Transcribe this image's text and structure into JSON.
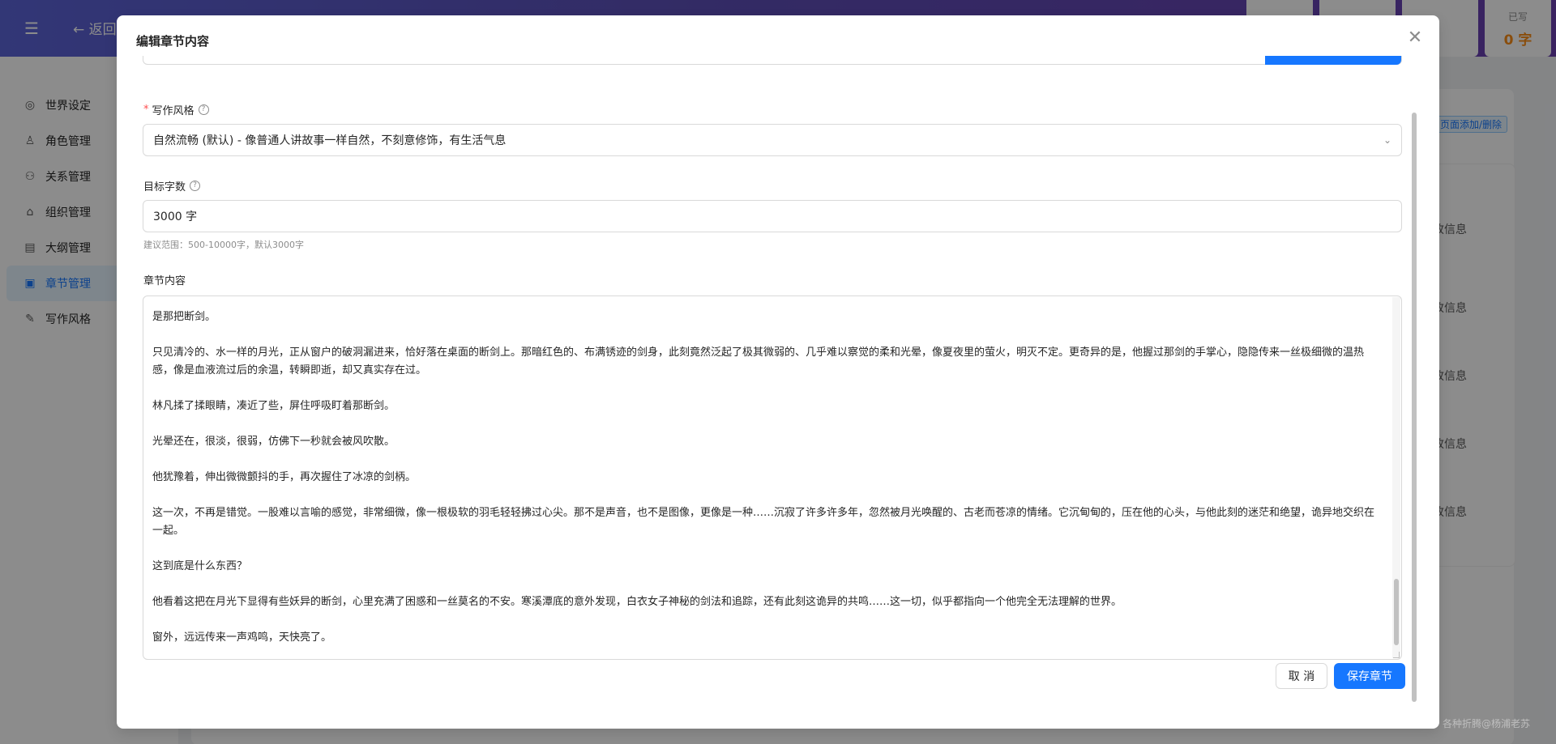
{
  "header": {
    "back_label": "返回",
    "stats": [
      {
        "label": "",
        "value": ""
      },
      {
        "label": "",
        "value": ""
      },
      {
        "label": "",
        "value": ""
      },
      {
        "label": "已写",
        "value": "0 字"
      }
    ]
  },
  "sidebar": {
    "items": [
      {
        "label": "世界设定",
        "icon": "globe-icon"
      },
      {
        "label": "角色管理",
        "icon": "user-icon"
      },
      {
        "label": "关系管理",
        "icon": "network-icon"
      },
      {
        "label": "组织管理",
        "icon": "bank-icon"
      },
      {
        "label": "大纲管理",
        "icon": "file-icon"
      },
      {
        "label": "章节管理",
        "icon": "book-icon"
      },
      {
        "label": "写作风格",
        "icon": "pen-icon"
      }
    ]
  },
  "main": {
    "tag_link": "页面添加/删除",
    "row_action": "改信息",
    "watermark": "各种折腾@杨浦老苏"
  },
  "modal": {
    "title": "编辑章节内容",
    "style_label": "写作风格",
    "style_value": "自然流畅 (默认) - 像普通人讲故事一样自然，不刻意修饰，有生活气息",
    "words_label": "目标字数",
    "words_value": "3000 字",
    "words_hint": "建议范围：500-10000字，默认3000字",
    "content_label": "章节内容",
    "content_paragraphs": [
      "是那把断剑。",
      "只见清冷的、水一样的月光，正从窗户的破洞漏进来，恰好落在桌面的断剑上。那暗红色的、布满锈迹的剑身，此刻竟然泛起了极其微弱的、几乎难以察觉的柔和光晕，像夏夜里的萤火，明灭不定。更奇异的是，他握过那剑的手掌心，隐隐传来一丝极细微的温热感，像是血液流过后的余温，转瞬即逝，却又真实存在过。",
      "林凡揉了揉眼睛，凑近了些，屏住呼吸盯着那断剑。",
      "光晕还在，很淡，很弱，仿佛下一秒就会被风吹散。",
      "他犹豫着，伸出微微颤抖的手，再次握住了冰凉的剑柄。",
      "这一次，不再是错觉。一股难以言喻的感觉，非常细微，像一根极软的羽毛轻轻拂过心尖。那不是声音，也不是图像，更像是一种……沉寂了许多许多年，忽然被月光唤醒的、古老而苍凉的情绪。它沉甸甸的，压在他的心头，与他此刻的迷茫和绝望，诡异地交织在一起。",
      "这到底是什么东西？",
      "他看着这把在月光下显得有些妖异的断剑，心里充满了困惑和一丝莫名的不安。寒溪潭底的意外发现，白衣女子神秘的剑法和追踪，还有此刻这诡异的共鸣……这一切，似乎都指向一个他完全无法理解的世界。",
      "窗外，远远传来一声鸡鸣，天快亮了。"
    ],
    "cancel_label": "取 消",
    "save_label": "保存章节"
  }
}
